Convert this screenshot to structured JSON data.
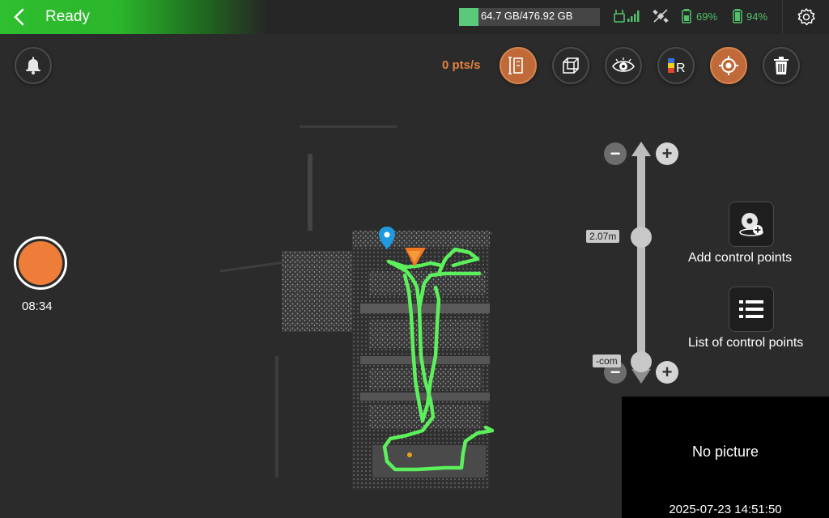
{
  "status": {
    "title": "Ready"
  },
  "storage": {
    "text": "64.7 GB/476.92 GB",
    "used_fraction": 0.1357
  },
  "indicators": {
    "rc_battery": "69%",
    "device_battery": "94%"
  },
  "toolbar": {
    "points_rate": "0 pts/s",
    "icons": [
      "measure-icon",
      "cube-icon",
      "eye-icon",
      "color-render-icon",
      "target-icon",
      "trash-icon"
    ],
    "active": [
      "measure-icon",
      "target-icon"
    ]
  },
  "recording": {
    "time": "08:34"
  },
  "height_slider": {
    "top_label": "2.07m",
    "bottom_label": "-com",
    "top_level": 0.38,
    "bottom_level": 0.95
  },
  "control_points": {
    "add_label": "Add control points",
    "list_label": "List of control points"
  },
  "camera": {
    "placeholder": "No picture",
    "timestamp": "2025-07-23 14:51:50"
  },
  "colors": {
    "accent": "#e5823e",
    "ready_green": "#2fbf2f",
    "track_green": "#5cf05c",
    "marker_blue": "#1e9be0"
  }
}
